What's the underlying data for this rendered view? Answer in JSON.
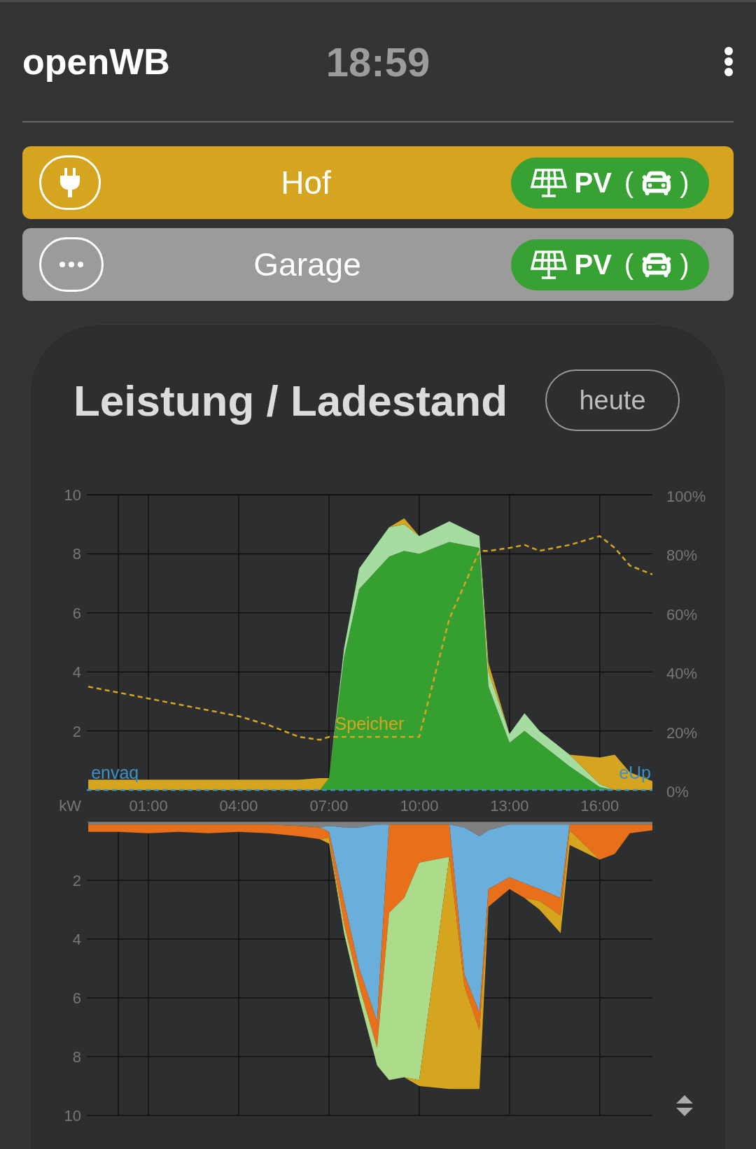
{
  "header": {
    "title": "openWB",
    "time": "18:59"
  },
  "chargepoints": [
    {
      "name": "Hof",
      "color": "#d6a520",
      "kind": "plugged",
      "mode": "PV",
      "bracket_open": "(",
      "bracket_close": ")"
    },
    {
      "name": "Garage",
      "color": "#9b9b9b",
      "kind": "idle",
      "mode": "PV",
      "bracket_open": "(",
      "bracket_close": ")"
    }
  ],
  "card": {
    "title": "Leistung / Ladestand",
    "range_button": "heute"
  },
  "charts": [
    {
      "chart_data": {
        "type": "area",
        "stacked": true,
        "grid": true,
        "ylabel": "kW",
        "xlim": [
          -1.05,
          17.75
        ],
        "ylim": [
          0,
          10
        ],
        "yticks": [
          2,
          4,
          6,
          8,
          10
        ],
        "ref_lines": [
          {
            "axis": "x",
            "value": 0
          }
        ],
        "x": [
          -1,
          0,
          1,
          2,
          3,
          4,
          5,
          6,
          6.7,
          7,
          7.5,
          8,
          9,
          9.5,
          10,
          11,
          12,
          12.3,
          13,
          13.5,
          14,
          15,
          16,
          16.5,
          17,
          17.75
        ],
        "series": [
          {
            "color": "#35a02f",
            "values": [
              0,
              0,
              0,
              0,
              0,
              0,
              0,
              0,
              0,
              0.4,
              4.5,
              6.8,
              7.9,
              8.1,
              8.0,
              8.4,
              8.2,
              3.5,
              1.6,
              2.0,
              1.6,
              0.8,
              0.1,
              0,
              0,
              0
            ]
          },
          {
            "color": "#a5dca0",
            "values": [
              0,
              0,
              0,
              0,
              0,
              0,
              0,
              0,
              0,
              0,
              0.3,
              0.7,
              1.0,
              0.9,
              0.6,
              0.7,
              0.4,
              0.5,
              0.3,
              0.6,
              0.4,
              0.4,
              0.1,
              0,
              0,
              0
            ]
          },
          {
            "color": "#d6a520",
            "values": [
              0.35,
              0.35,
              0.35,
              0.35,
              0.35,
              0.35,
              0.35,
              0.35,
              0.4,
              0,
              0,
              0,
              0,
              0.2,
              0,
              0,
              0,
              0.3,
              0,
              0,
              0,
              0,
              0.9,
              1.2,
              0.6,
              0.3
            ]
          }
        ]
      }
    },
    {
      "chart_data": {
        "type": "line",
        "xlim": [
          -1.05,
          17.75
        ],
        "xticks": [
          {
            "value": 1,
            "label": "01:00"
          },
          {
            "value": 4,
            "label": "04:00"
          },
          {
            "value": 7,
            "label": "07:00"
          },
          {
            "value": 10,
            "label": "10:00"
          },
          {
            "value": 13,
            "label": "13:00"
          },
          {
            "value": 16,
            "label": "16:00"
          }
        ],
        "ylim": [
          0,
          100
        ],
        "yticks": [
          {
            "value": 0,
            "label": "0%"
          },
          {
            "value": 20,
            "label": "20%"
          },
          {
            "value": 40,
            "label": "40%"
          },
          {
            "value": 60,
            "label": "60%"
          },
          {
            "value": 80,
            "label": "80%"
          },
          {
            "value": 100,
            "label": "100%"
          }
        ],
        "x": [
          -1,
          0,
          1,
          2,
          3,
          4,
          5,
          6,
          6.7,
          7,
          7.5,
          8,
          9,
          9.5,
          10,
          11,
          12,
          12.3,
          13,
          13.5,
          14,
          15,
          16,
          16.5,
          17,
          17.75
        ],
        "series": [
          {
            "name": "Speicher",
            "color": "#d6a520",
            "line_style": "dashed",
            "values": [
              35,
              33,
              31,
              29,
              27,
              25,
              22,
              18,
              17,
              18,
              18,
              18,
              18,
              18,
              18,
              58,
              81,
              81,
              82,
              83,
              81,
              83,
              86,
              82,
              76,
              73
            ]
          }
        ],
        "ref_lines": [
          {
            "axis": "y",
            "value": 0,
            "color": "#3d8fc4",
            "line_style": "dashed"
          }
        ],
        "annotations": [
          {
            "text": "envaq",
            "x": -1,
            "y": 0
          },
          {
            "text": "eUp",
            "x": 17.75,
            "y": 0
          }
        ]
      }
    },
    {
      "chart_data": {
        "type": "area",
        "stacked": true,
        "grid": true,
        "xlim": [
          -1.05,
          17.75
        ],
        "ylim": [
          10,
          0
        ],
        "yticks": [
          2,
          4,
          6,
          8,
          10
        ],
        "x": [
          -1,
          0,
          1,
          2,
          3,
          4,
          5,
          6,
          6.7,
          7,
          7.5,
          8,
          8.6,
          9,
          9.5,
          10,
          11,
          11.5,
          12,
          12.3,
          13,
          13.5,
          14,
          14.7,
          15,
          16,
          16.5,
          17,
          17.75
        ],
        "series": [
          {
            "color": "#808080",
            "values": [
              0.1,
              0.1,
              0.1,
              0.1,
              0.1,
              0.1,
              0.1,
              0.15,
              0.2,
              0.15,
              0.2,
              0.2,
              0.1,
              0.1,
              0.1,
              0.1,
              0.1,
              0.2,
              0.5,
              0.3,
              0.1,
              0.1,
              0.1,
              0.1,
              0.1,
              0.1,
              0.1,
              0.1,
              0.1
            ]
          },
          {
            "color": "#6aaedb",
            "values": [
              0,
              0,
              0,
              0,
              0,
              0,
              0,
              0,
              0,
              0.2,
              2.5,
              4.8,
              6.7,
              0,
              0,
              0,
              0,
              5.0,
              6.0,
              2.0,
              1.8,
              2.0,
              2.2,
              2.5,
              0,
              0,
              0,
              0,
              0
            ]
          },
          {
            "color": "#e8701a",
            "values": [
              0.25,
              0.25,
              0.3,
              0.25,
              0.3,
              0.25,
              0.3,
              0.35,
              0.4,
              0.2,
              0.8,
              0.6,
              0.9,
              3.0,
              2.5,
              1.3,
              1.1,
              0.4,
              0.6,
              0.6,
              0.4,
              0.5,
              0.4,
              0.6,
              0.2,
              1.2,
              1.0,
              0.3,
              0.2
            ]
          },
          {
            "color": "#acdc8a",
            "values": [
              0,
              0,
              0,
              0,
              0,
              0,
              0,
              0,
              0,
              0,
              0.3,
              0.4,
              0.6,
              5.7,
              6.1,
              7.4,
              0,
              0,
              0,
              0,
              0,
              0,
              0,
              0,
              0,
              0,
              0,
              0,
              0
            ]
          },
          {
            "color": "#d6a520",
            "values": [
              0,
              0,
              0,
              0,
              0,
              0,
              0,
              0,
              0,
              0.2,
              0,
              0,
              0,
              0,
              0,
              0.2,
              7.9,
              3.5,
              2.0,
              0,
              0,
              0,
              0.3,
              0.6,
              0.5,
              0,
              0,
              0,
              0
            ]
          }
        ]
      }
    }
  ]
}
